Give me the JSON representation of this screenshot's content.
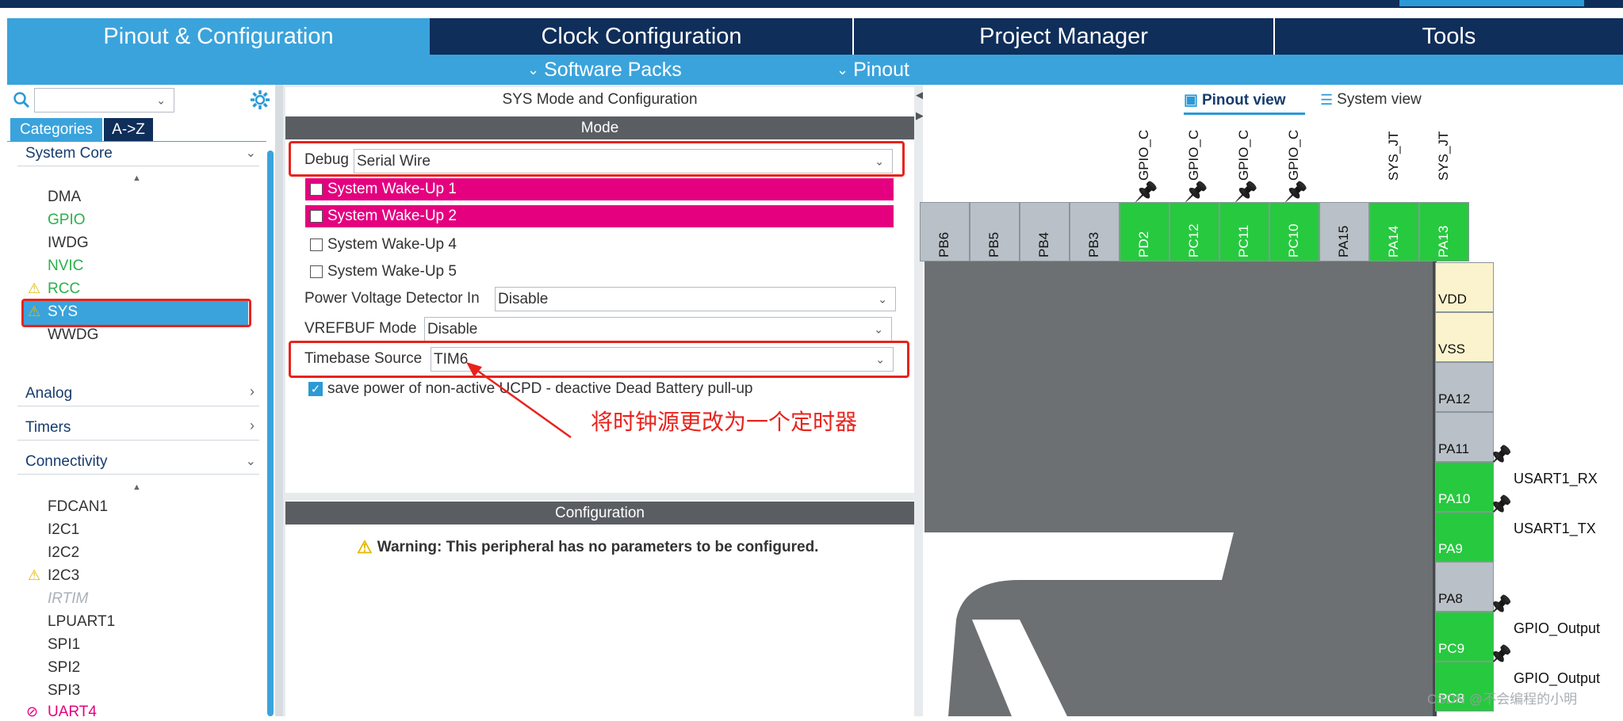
{
  "tabs": {
    "pinout": "Pinout & Configuration",
    "clock": "Clock Configuration",
    "project": "Project Manager",
    "tools": "Tools"
  },
  "subtabs": {
    "software_packs": "Software Packs",
    "pinout": "Pinout"
  },
  "sidebar": {
    "search_placeholder": "",
    "tab_categories": "Categories",
    "tab_az": "A->Z",
    "sections": {
      "system_core": "System Core",
      "analog": "Analog",
      "timers": "Timers",
      "connectivity": "Connectivity"
    },
    "system_core_items": [
      {
        "label": "DMA",
        "state": "normal"
      },
      {
        "label": "GPIO",
        "state": "configured"
      },
      {
        "label": "IWDG",
        "state": "normal"
      },
      {
        "label": "NVIC",
        "state": "configured"
      },
      {
        "label": "RCC",
        "state": "warning"
      },
      {
        "label": "SYS",
        "state": "selected"
      },
      {
        "label": "WWDG",
        "state": "normal"
      }
    ],
    "connectivity_items": [
      {
        "label": "FDCAN1",
        "state": "normal"
      },
      {
        "label": "I2C1",
        "state": "normal"
      },
      {
        "label": "I2C2",
        "state": "normal"
      },
      {
        "label": "I2C3",
        "state": "warning"
      },
      {
        "label": "IRTIM",
        "state": "disabled"
      },
      {
        "label": "LPUART1",
        "state": "normal"
      },
      {
        "label": "SPI1",
        "state": "normal"
      },
      {
        "label": "SPI2",
        "state": "normal"
      },
      {
        "label": "SPI3",
        "state": "normal"
      },
      {
        "label": "UART4",
        "state": "error"
      }
    ]
  },
  "mode_panel": {
    "title": "SYS Mode and Configuration",
    "mode_header": "Mode",
    "debug_label": "Debug",
    "debug_value": "Serial Wire",
    "wakeups": [
      {
        "label": "System Wake-Up 1",
        "highlighted": true,
        "checked": false
      },
      {
        "label": "System Wake-Up 2",
        "highlighted": true,
        "checked": false
      },
      {
        "label": "System Wake-Up 4",
        "highlighted": false,
        "checked": false
      },
      {
        "label": "System Wake-Up 5",
        "highlighted": false,
        "checked": false
      }
    ],
    "pvd_label": "Power Voltage Detector In",
    "pvd_value": "Disable",
    "vrefbuf_label": "VREFBUF Mode",
    "vrefbuf_value": "Disable",
    "timebase_label": "Timebase Source",
    "timebase_value": "TIM6",
    "save_power_label": "save power of non-active UCPD - deactive Dead Battery pull-up",
    "save_power_checked": true,
    "annotation": "将时钟源更改为一个定时器",
    "config_header": "Configuration",
    "warning": "Warning: This peripheral has no parameters to be configured."
  },
  "pinout_view": {
    "pinout_view_label": "Pinout view",
    "system_view_label": "System view",
    "top_pins": [
      {
        "name": "PB6",
        "color": "gray",
        "label": "",
        "pinned": false
      },
      {
        "name": "PB5",
        "color": "gray",
        "label": "",
        "pinned": false
      },
      {
        "name": "PB4",
        "color": "gray",
        "label": "",
        "pinned": false
      },
      {
        "name": "PB3",
        "color": "gray",
        "label": "",
        "pinned": false
      },
      {
        "name": "PD2",
        "color": "green",
        "label": "GPIO_C",
        "pinned": true
      },
      {
        "name": "PC12",
        "color": "green",
        "label": "GPIO_C",
        "pinned": true
      },
      {
        "name": "PC11",
        "color": "green",
        "label": "GPIO_C",
        "pinned": true
      },
      {
        "name": "PC10",
        "color": "green",
        "label": "GPIO_C",
        "pinned": true
      },
      {
        "name": "PA15",
        "color": "gray",
        "label": "",
        "pinned": false
      },
      {
        "name": "PA14",
        "color": "green",
        "label": "SYS_JT",
        "pinned": false
      },
      {
        "name": "PA13",
        "color": "green",
        "label": "SYS_JT",
        "pinned": false
      }
    ],
    "right_pins": [
      {
        "name": "VDD",
        "color": "yellow",
        "label": "",
        "pinned": false
      },
      {
        "name": "VSS",
        "color": "yellow",
        "label": "",
        "pinned": false
      },
      {
        "name": "PA12",
        "color": "gray",
        "label": "",
        "pinned": false
      },
      {
        "name": "PA11",
        "color": "gray",
        "label": "",
        "pinned": true
      },
      {
        "name": "PA10",
        "color": "green",
        "label": "USART1_RX",
        "pinned": true
      },
      {
        "name": "PA9",
        "color": "green",
        "label": "USART1_TX",
        "pinned": false
      },
      {
        "name": "PA8",
        "color": "gray",
        "label": "",
        "pinned": true
      },
      {
        "name": "PC9",
        "color": "green",
        "label": "GPIO_Output",
        "pinned": true
      },
      {
        "name": "PC8",
        "color": "green",
        "label": "GPIO_Output",
        "pinned": false
      }
    ],
    "watermark": "CSDN @不会编程的小明"
  },
  "colors": {
    "dark_navy": "#0f2e5a",
    "accent_blue": "#3aa3dc",
    "pin_green": "#27c93f",
    "pin_gray": "#b9c0c7",
    "highlight_pink": "#e4007f",
    "annotation_red": "#e8231d"
  }
}
